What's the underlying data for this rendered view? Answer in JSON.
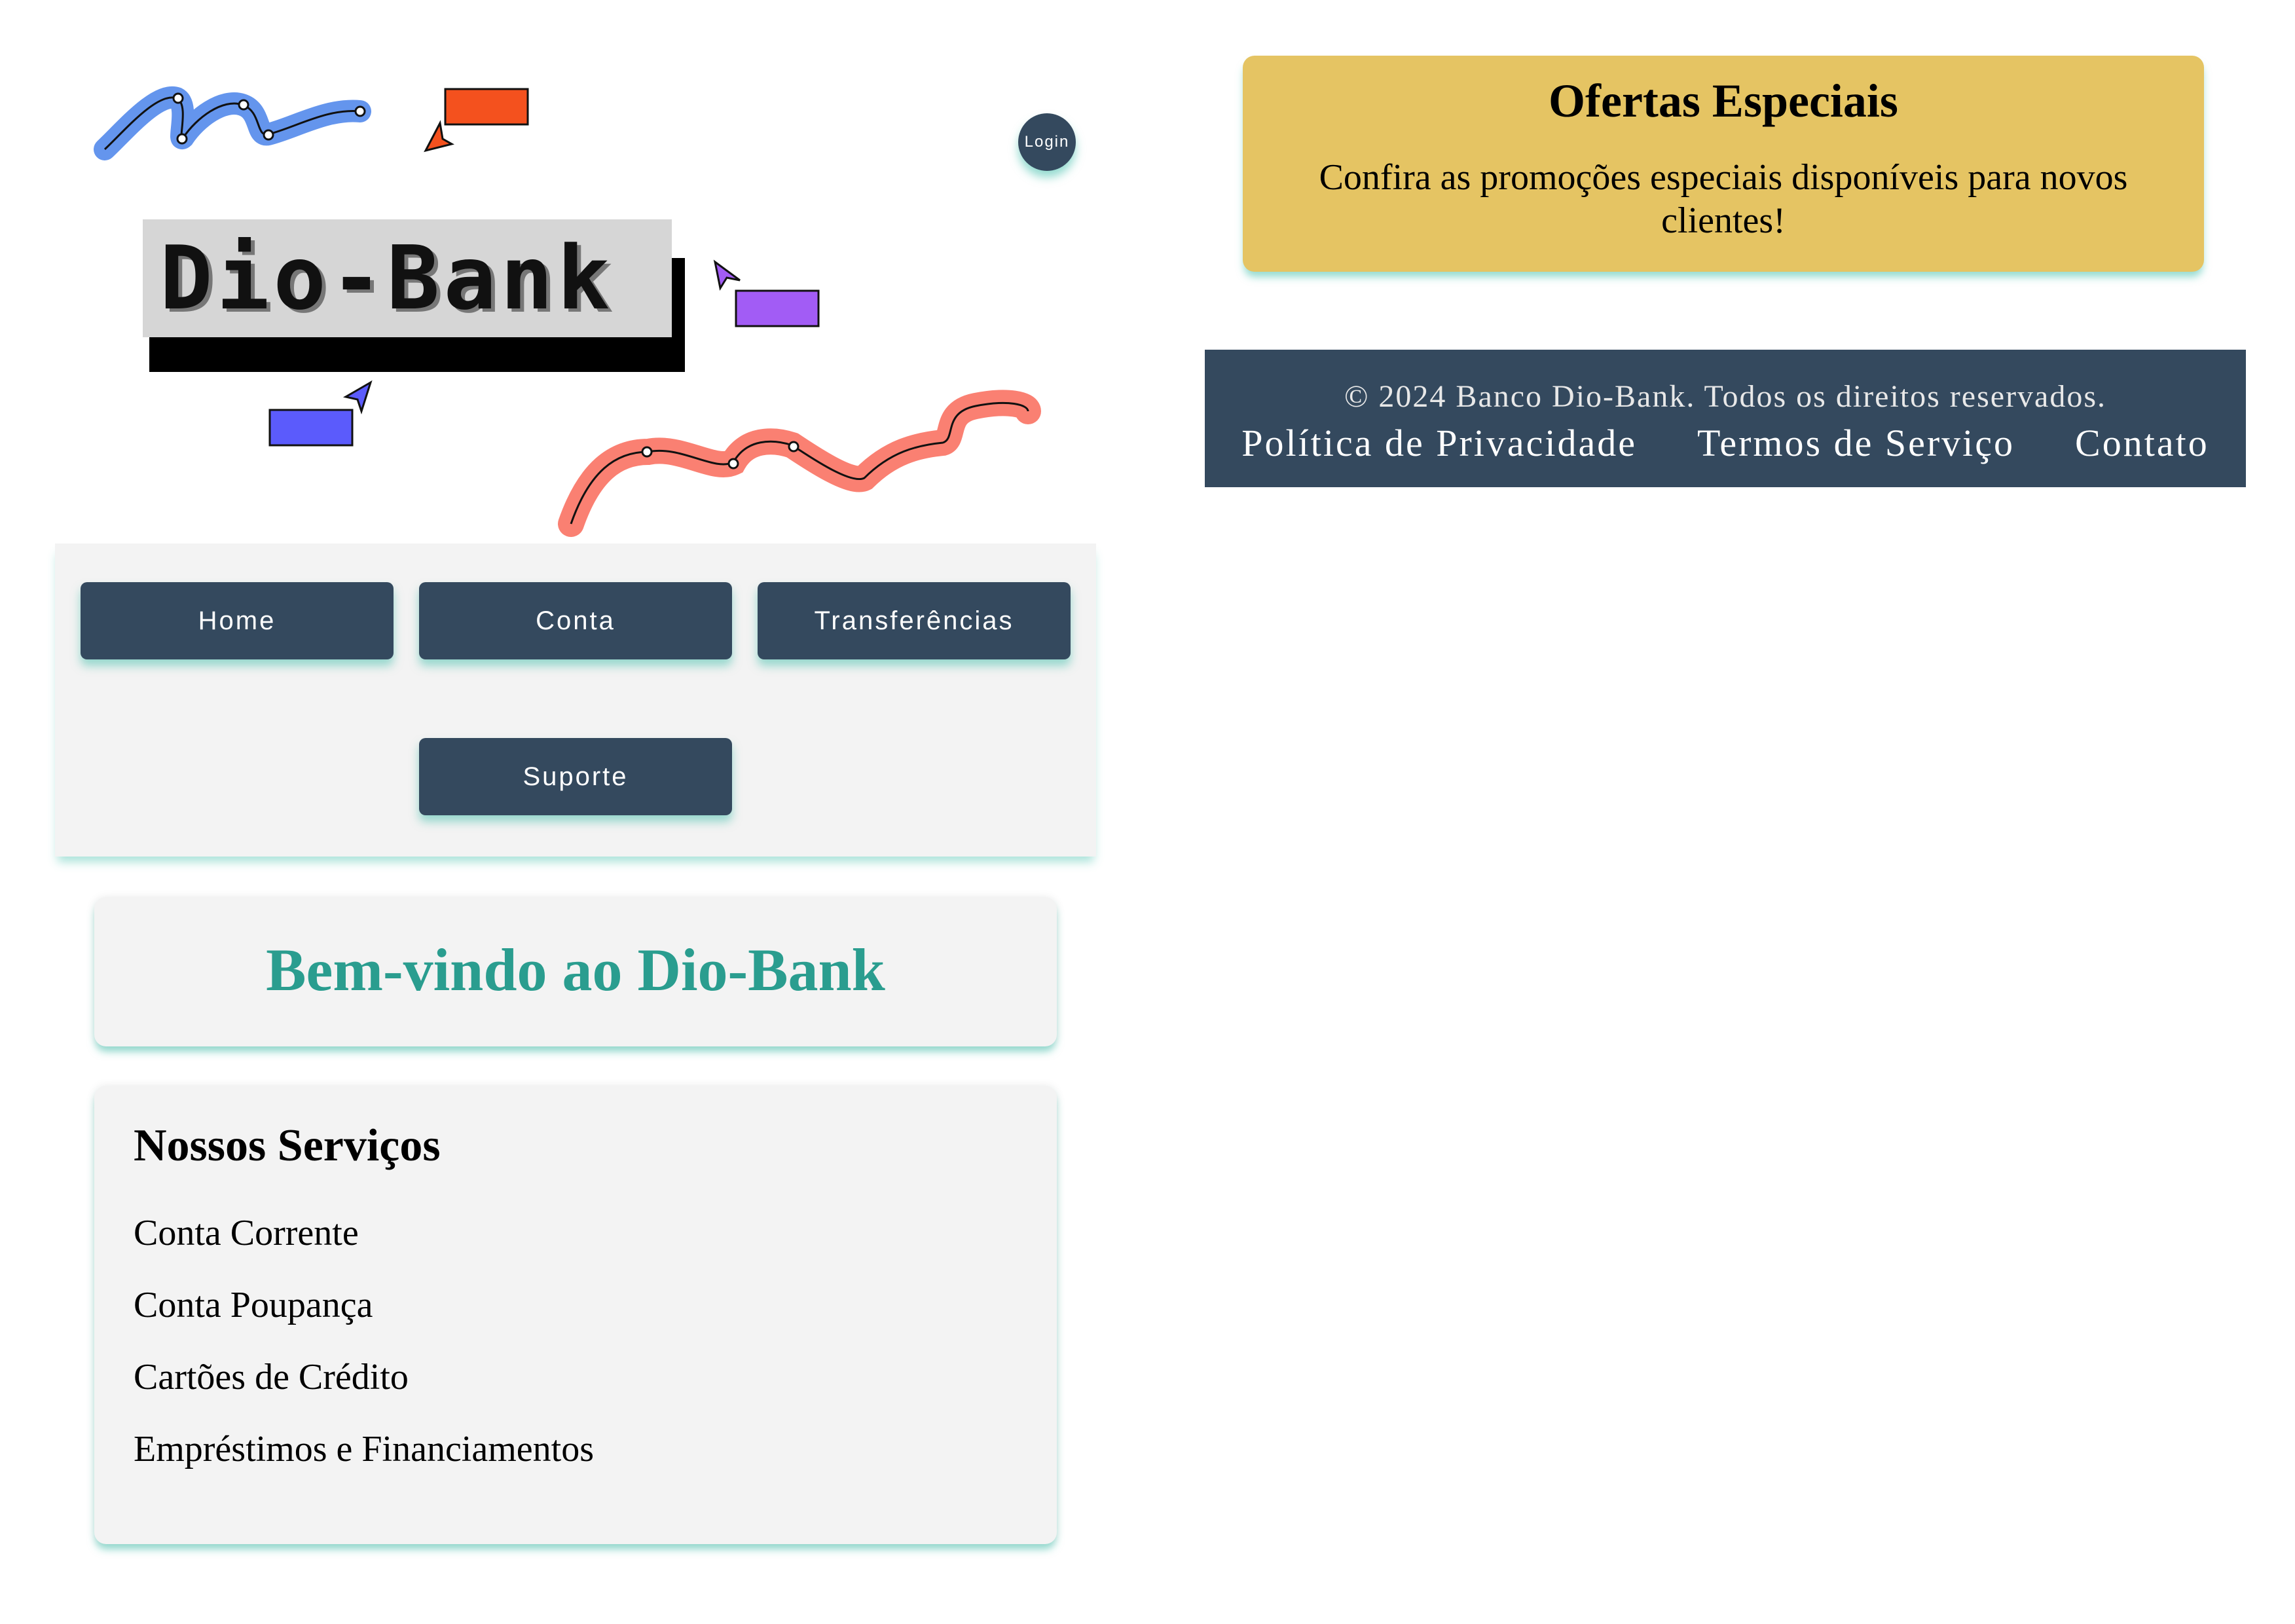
{
  "header": {
    "logo_text": "Dio-Bank",
    "login_label": "Login"
  },
  "nav": {
    "items": [
      {
        "label": "Home"
      },
      {
        "label": "Conta"
      },
      {
        "label": "Transferências"
      },
      {
        "label": "Suporte"
      }
    ]
  },
  "welcome": {
    "title": "Bem-vindo ao Dio-Bank"
  },
  "services": {
    "title": "Nossos Serviços",
    "items": [
      "Conta Corrente",
      "Conta Poupança",
      "Cartões de Crédito",
      "Empréstimos e Financiamentos"
    ]
  },
  "offers": {
    "title": "Ofertas Especiais",
    "text": "Confira as promoções especiais disponíveis para novos clientes!"
  },
  "footer": {
    "copyright": "© 2024 Banco Dio-Bank. Todos os direitos reservados.",
    "links": [
      "Política de Privacidade",
      "Termos de Serviço",
      "Contato"
    ]
  },
  "colors": {
    "primary": "#34495e",
    "accent": "#2a9d8f",
    "offers_bg": "#e5c463",
    "shadow_teal": "#3ebeaa",
    "panel_bg": "#f3f3f3"
  }
}
